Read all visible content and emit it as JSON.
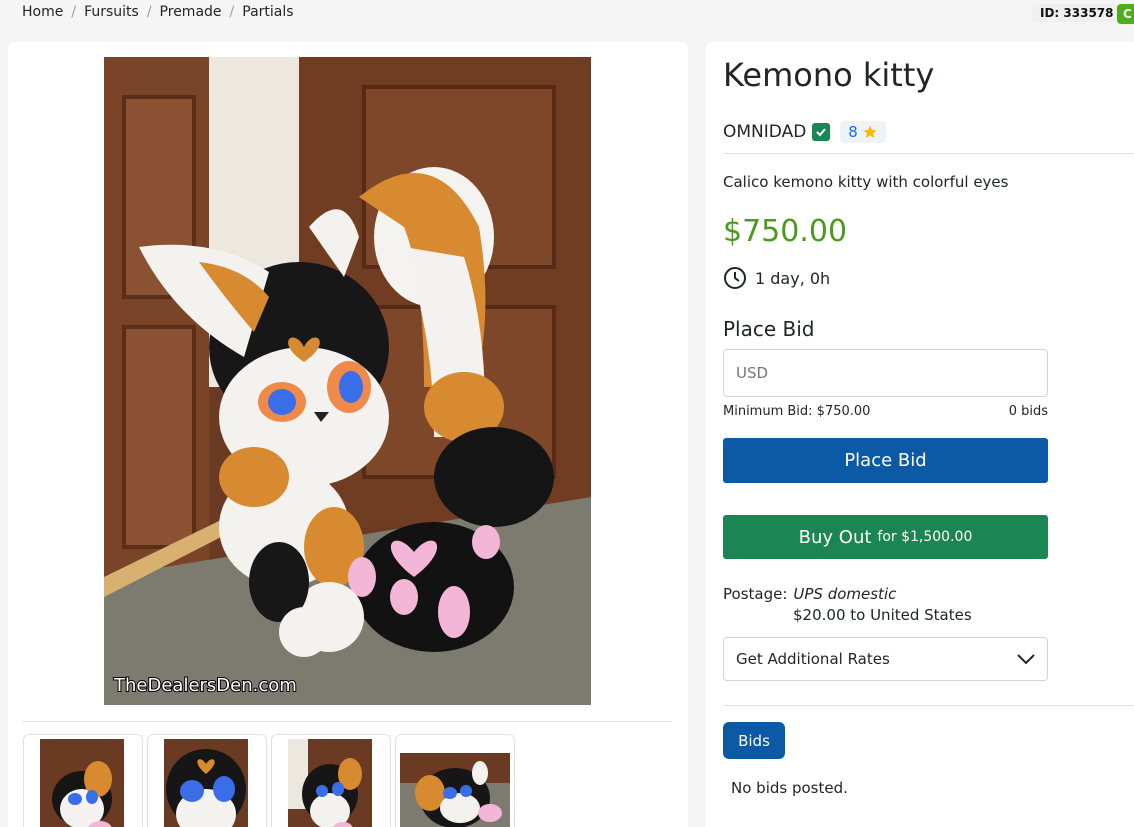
{
  "breadcrumb": [
    "Home",
    "Fursuits",
    "Premade",
    "Partials"
  ],
  "listing_id": "ID: 333578",
  "status_badge": "C",
  "product": {
    "title": "Kemono kitty",
    "seller": "OMNIDAD",
    "rating": "8",
    "description": "Calico kemono kitty with colorful eyes",
    "price": "$750.00",
    "time_left": "1 day, 0h"
  },
  "bid": {
    "heading": "Place Bid",
    "placeholder": "USD",
    "minimum": "Minimum Bid: $750.00",
    "count": "0 bids",
    "button": "Place Bid"
  },
  "buyout": {
    "label": "Buy Out",
    "price": "for $1,500.00"
  },
  "postage": {
    "label": "Postage:",
    "service": "UPS domestic",
    "cost": "$20.00 to United States",
    "rates_label": "Get Additional Rates"
  },
  "bids_section": {
    "tab": "Bids",
    "empty": "No bids posted."
  },
  "watermark": "TheDealersDen.com",
  "colors": {
    "accent_blue": "#0c5aa6",
    "buy_green": "#1b8553",
    "price_green": "#4c9a1c"
  }
}
